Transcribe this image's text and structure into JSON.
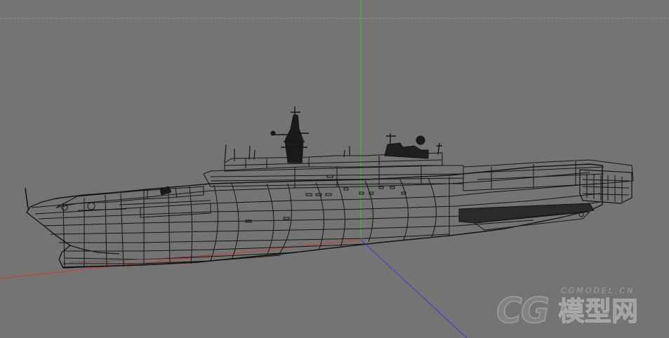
{
  "viewport": {
    "background": "#747474",
    "grid_horizon": "dashed",
    "axes": {
      "x_axis_color": "#c83c3c",
      "y_axis_color": "#3cbc3c",
      "z_axis_color": "#3c3cd8"
    },
    "model": {
      "name": "ship-wireframe",
      "display": "wireframe",
      "wire_color": "#141414"
    }
  },
  "watermark": {
    "logo_text": "CG",
    "cn_text": "模型网",
    "domain_text": "CGMODEL.CN"
  }
}
